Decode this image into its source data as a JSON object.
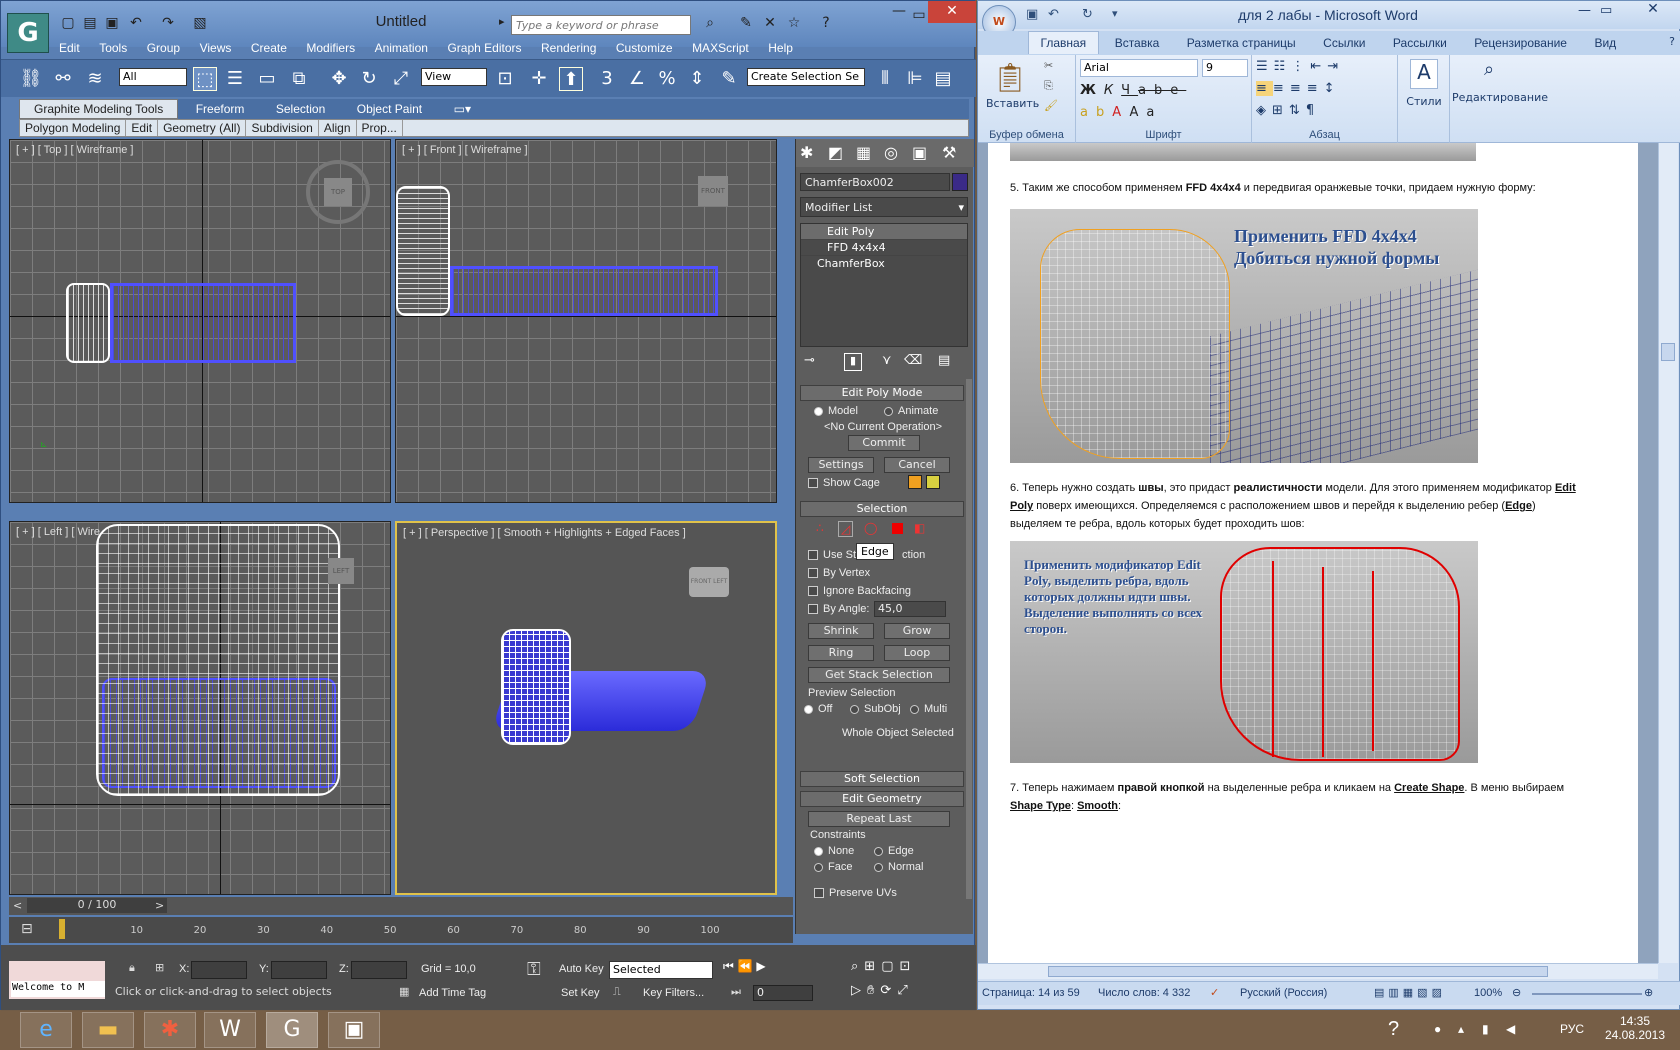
{
  "max": {
    "title": "Untitled",
    "search_placeholder": "Type a keyword or phrase",
    "menu": [
      "Edit",
      "Tools",
      "Group",
      "Views",
      "Create",
      "Modifiers",
      "Animation",
      "Graph Editors",
      "Rendering",
      "Customize",
      "MAXScript",
      "Help"
    ],
    "filter_all": "All",
    "view_select": "View",
    "create_selection_set": "Create Selection Se",
    "ribbon_tabs": [
      "Graphite Modeling Tools",
      "Freeform",
      "Selection",
      "Object Paint"
    ],
    "ribbon_sub": [
      "Polygon Modeling",
      "Edit",
      "Geometry (All)",
      "Subdivision",
      "Align",
      "Prop..."
    ],
    "viewports": {
      "top": "[ + ] [ Top ] [ Wireframe ]",
      "front": "[ + ] [ Front ] [ Wireframe ]",
      "left": "[ + ] [ Left ] [ Wire",
      "perspective": "[ + ] [ Perspective ] [ Smooth + Highlights + Edged Faces ]"
    },
    "cube_labels": {
      "top": "TOP",
      "front": "FRONT",
      "left": "LEFT",
      "persp_front": "FRONT",
      "persp_left": "LEFT"
    },
    "command_panel": {
      "object_name": "ChamferBox002",
      "modifier_list": "Modifier List",
      "stack": [
        "Edit Poly",
        "FFD 4x4x4",
        "ChamferBox"
      ],
      "edit_poly_mode": "Edit Poly Mode",
      "model": "Model",
      "animate": "Animate",
      "no_op": "<No Current Operation>",
      "commit": "Commit",
      "settings": "Settings",
      "cancel": "Cancel",
      "show_cage": "Show Cage",
      "selection": "Selection",
      "tooltip": "Edge",
      "use_stack": "Use St",
      "use_stack_tail": "ction",
      "by_vertex": "By Vertex",
      "ignore_backfacing": "Ignore Backfacing",
      "by_angle": "By Angle:",
      "angle_value": "45,0",
      "shrink": "Shrink",
      "grow": "Grow",
      "ring": "Ring",
      "loop": "Loop",
      "get_stack": "Get Stack Selection",
      "preview_selection": "Preview Selection",
      "off": "Off",
      "subobj": "SubObj",
      "multi": "Multi",
      "whole_object": "Whole Object Selected",
      "soft_selection": "Soft Selection",
      "edit_geometry": "Edit Geometry",
      "repeat_last": "Repeat Last",
      "constraints": "Constraints",
      "none": "None",
      "edge": "Edge",
      "face": "Face",
      "normal": "Normal",
      "preserve_uvs": "Preserve UVs"
    },
    "timeline": {
      "frame": "0 / 100",
      "ticks": [
        "10",
        "20",
        "30",
        "40",
        "50",
        "60",
        "70",
        "80",
        "90",
        "100"
      ]
    },
    "status": {
      "listener": "Welcome to M",
      "x_label": "X:",
      "y_label": "Y:",
      "z_label": "Z:",
      "grid": "Grid = 10,0",
      "auto_key": "Auto Key",
      "selected": "Selected",
      "set_key": "Set Key",
      "key_filters": "Key Filters...",
      "prompt": "Click or click-and-drag to select objects",
      "add_time_tag": "Add Time Tag",
      "frame_field": "0"
    }
  },
  "word": {
    "title": "для 2 лабы - Microsoft Word",
    "tabs": [
      "Главная",
      "Вставка",
      "Разметка страницы",
      "Ссылки",
      "Рассылки",
      "Рецензирование",
      "Вид"
    ],
    "groups": {
      "clipboard": "Буфер обмена",
      "paste": "Вставить",
      "font": "Шрифт",
      "font_name": "Arial",
      "font_size": "9",
      "paragraph": "Абзац",
      "styles": "Стили",
      "editing": "Редактирование"
    },
    "doc": {
      "step5_pre": "5. Таким же способом применяем ",
      "step5_bold": "FFD 4x4x4",
      "step5_post": " и передвигая оранжевые точки, придаем нужную форму:",
      "img1_line1": "Применить FFD 4x4x4",
      "img1_line2": "Добиться нужной формы",
      "step6_a": "6. Теперь нужно создать ",
      "step6_b": "швы",
      "step6_c": ", это придаст ",
      "step6_d": "реалистичности",
      "step6_e": " модели. Для этого применяем модификатор ",
      "step6_f": "Edit",
      "step6_line2_a": "Poly",
      "step6_line2_b": " поверх имеющихся. Определяемся с расположением швов и перейдя к выделению ребер (",
      "step6_line2_c": "Edge",
      "step6_line2_d": ")",
      "step6_line3": "выделяем те ребра, вдоль которых будет проходить шов:",
      "img2_text": "Применить модификатор Edit Poly, выделить ребра, вдоль которых должны идти швы. Выделение выполнять со всех сторон.",
      "step7_a": "7. Теперь нажимаем ",
      "step7_b": "правой  кнопкой",
      "step7_c": "  на выделенные ребра и кликаем на ",
      "step7_d": "Create Shape",
      "step7_e": ".  В меню выбираем",
      "step7_line2_a": "Shape Type",
      "step7_line2_b": ":  ",
      "step7_line2_c": "Smooth",
      "step7_line2_d": ":"
    },
    "status": {
      "page": "Страница: 14 из 59",
      "words": "Число слов: 4 332",
      "lang": "Русский (Россия)",
      "zoom": "100%"
    }
  },
  "taskbar": {
    "lang": "РУС",
    "time": "14:35",
    "date": "24.08.2013"
  },
  "colors": {
    "max_blue": "#5a7fb3",
    "wire_blue": "#4b4bd6",
    "word_blue": "#d4e1f3",
    "edge_red": "#e00000",
    "orange": "#f0a020"
  }
}
